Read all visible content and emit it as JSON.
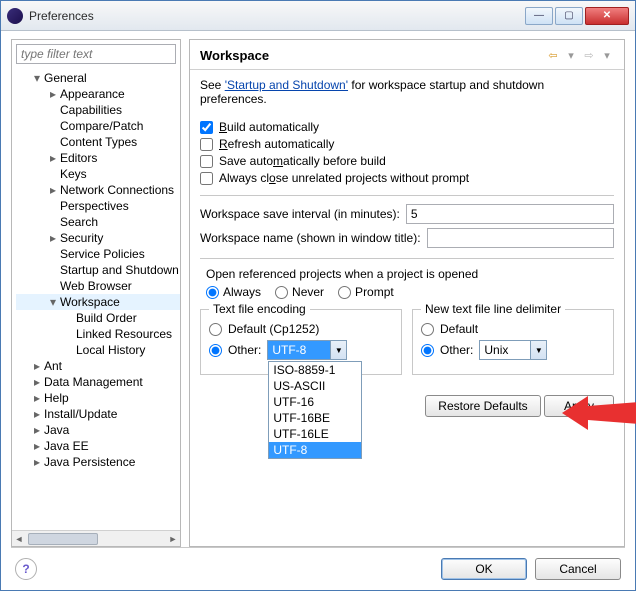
{
  "window": {
    "title": "Preferences"
  },
  "filter_placeholder": "type filter text",
  "tree": {
    "items": [
      {
        "label": "General",
        "level": 1,
        "toggle": "▾"
      },
      {
        "label": "Appearance",
        "level": 2,
        "toggle": "▸"
      },
      {
        "label": "Capabilities",
        "level": 2,
        "toggle": ""
      },
      {
        "label": "Compare/Patch",
        "level": 2,
        "toggle": ""
      },
      {
        "label": "Content Types",
        "level": 2,
        "toggle": ""
      },
      {
        "label": "Editors",
        "level": 2,
        "toggle": "▸"
      },
      {
        "label": "Keys",
        "level": 2,
        "toggle": ""
      },
      {
        "label": "Network Connections",
        "level": 2,
        "toggle": "▸"
      },
      {
        "label": "Perspectives",
        "level": 2,
        "toggle": ""
      },
      {
        "label": "Search",
        "level": 2,
        "toggle": ""
      },
      {
        "label": "Security",
        "level": 2,
        "toggle": "▸"
      },
      {
        "label": "Service Policies",
        "level": 2,
        "toggle": ""
      },
      {
        "label": "Startup and Shutdown",
        "level": 2,
        "toggle": ""
      },
      {
        "label": "Web Browser",
        "level": 2,
        "toggle": ""
      },
      {
        "label": "Workspace",
        "level": 2,
        "toggle": "▾",
        "selected": true
      },
      {
        "label": "Build Order",
        "level": 3,
        "toggle": ""
      },
      {
        "label": "Linked Resources",
        "level": 3,
        "toggle": ""
      },
      {
        "label": "Local History",
        "level": 3,
        "toggle": ""
      },
      {
        "label": "Ant",
        "level": 1,
        "toggle": "▸"
      },
      {
        "label": "Data Management",
        "level": 1,
        "toggle": "▸"
      },
      {
        "label": "Help",
        "level": 1,
        "toggle": "▸"
      },
      {
        "label": "Install/Update",
        "level": 1,
        "toggle": "▸"
      },
      {
        "label": "Java",
        "level": 1,
        "toggle": "▸"
      },
      {
        "label": "Java EE",
        "level": 1,
        "toggle": "▸"
      },
      {
        "label": "Java Persistence",
        "level": 1,
        "toggle": "▸"
      }
    ]
  },
  "page": {
    "heading": "Workspace",
    "see_prefix": "See ",
    "see_link": "'Startup and Shutdown'",
    "see_suffix": " for workspace startup and shutdown preferences.",
    "checkboxes": {
      "build_auto": {
        "label": "Build automatically",
        "u": "B",
        "checked": true
      },
      "refresh_auto": {
        "label": "efresh automatically",
        "u": "R",
        "checked": false
      },
      "save_before_build": {
        "label": "Save auto",
        "mid": "m",
        "rest": "atically before build",
        "checked": false
      },
      "close_unrelated": {
        "label": "Always cl",
        "mid": "o",
        "rest": "se unrelated projects without prompt",
        "checked": false
      }
    },
    "save_interval": {
      "label_pre": "W",
      "label_u": "o",
      "label_post": "rkspace save interval (in minutes):",
      "value": "5"
    },
    "ws_name": {
      "label": "Workspace name (shown in window title):",
      "value": ""
    },
    "ref_projects": {
      "label": "Open referenced projects when a project is opened",
      "always": {
        "u": "A",
        "rest": "lways"
      },
      "never": {
        "u": "N",
        "rest": "ever"
      },
      "prompt": {
        "u": "P",
        "rest": "rompt"
      }
    },
    "encoding": {
      "legend_u": "T",
      "legend_rest": "ext file encoding",
      "default": {
        "u": "D",
        "rest": "efault (Cp1252)"
      },
      "other": {
        "u": "O",
        "rest": "ther:"
      },
      "value": "UTF-8",
      "options": [
        "ISO-8859-1",
        "US-ASCII",
        "UTF-16",
        "UTF-16BE",
        "UTF-16LE",
        "UTF-8"
      ]
    },
    "newline": {
      "legend_pre": "Ne",
      "legend_u": "w",
      "legend_rest": " text file line delimiter",
      "default": {
        "pre": "De",
        "u": "f",
        "rest": "ault"
      },
      "other": {
        "pre": "Ot",
        "u": "h",
        "rest": "er:"
      },
      "value": "Unix"
    },
    "restore": "Restore Defaults",
    "apply": "Apply"
  },
  "footer": {
    "ok": "OK",
    "cancel": "Cancel"
  }
}
